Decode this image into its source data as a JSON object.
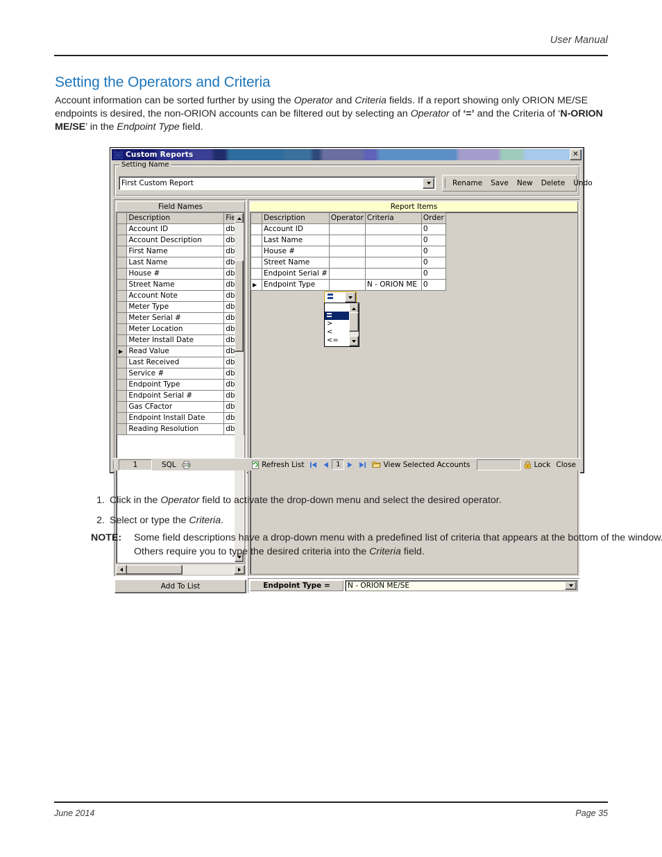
{
  "page": {
    "header_right": "User Manual",
    "footer_left": "June 2014",
    "footer_right": "Page 35",
    "section_title": "Setting the Operators and Criteria",
    "intro_parts": {
      "p1": "Account information can be sorted further by using the ",
      "i1": "Operator",
      "p2": " and ",
      "i2": "Criteria",
      "p3": " fields. If a report showing only ORION ME/SE endpoints is desired, the non-ORION accounts can be filtered out by selecting an ",
      "i3": "Operator",
      "p4": " of ",
      "b1": "‘=’",
      "p5": " and the Criteria of ‘",
      "b2": "N-ORION ME/SE",
      "p6": "’ in the ",
      "i4": "Endpoint Type",
      "p7": " field."
    },
    "steps": [
      {
        "num": "1.",
        "pre": "Click in the ",
        "em": "Operator",
        "post": " field to activate the drop-down menu and select the desired operator."
      },
      {
        "num": "2.",
        "pre": "Select or type the ",
        "em": "Criteria",
        "post": "."
      }
    ],
    "note": {
      "label": "NOTE:",
      "pre": "Some field descriptions have a drop-down menu with a predefined list of criteria that appears at the bottom of the window. Others require you to type the desired criteria into the ",
      "em": "Criteria",
      "post": " field."
    }
  },
  "dialog": {
    "title": "Custom Reports",
    "close_label": "✕",
    "group_label": "Setting Name",
    "setting_value": "First Custom Report",
    "command_buttons": [
      "Rename",
      "Save",
      "New",
      "Delete",
      "Undo"
    ],
    "field_names": {
      "panel_title": "Field Names",
      "columns": [
        "Description",
        "Fielc"
      ],
      "selected_row_index": 11,
      "rows": [
        {
          "description": "Account ID",
          "field": "dbf_"
        },
        {
          "description": "Account Description",
          "field": "dbf_"
        },
        {
          "description": "First Name",
          "field": "dbf_"
        },
        {
          "description": "Last Name",
          "field": "dbf_"
        },
        {
          "description": "House #",
          "field": "dbf_"
        },
        {
          "description": "Street Name",
          "field": "dbf_"
        },
        {
          "description": "Account Note",
          "field": "dbf_"
        },
        {
          "description": "Meter Type",
          "field": "dbf_"
        },
        {
          "description": "Meter Serial #",
          "field": "dbf_"
        },
        {
          "description": "Meter Location",
          "field": "dbf_"
        },
        {
          "description": "Meter Install Date",
          "field": "dbf_"
        },
        {
          "description": "Read Value",
          "field": "dbf_"
        },
        {
          "description": "Last Received",
          "field": "dbf_"
        },
        {
          "description": "Service #",
          "field": "dbf_"
        },
        {
          "description": "Endpoint Type",
          "field": "dbf_"
        },
        {
          "description": "Endpoint Serial #",
          "field": "dbf_"
        },
        {
          "description": "Gas CFactor",
          "field": "dbf_"
        },
        {
          "description": "Endpoint Install Date",
          "field": "dbf_"
        },
        {
          "description": "Reading Resolution",
          "field": "dbf_"
        }
      ],
      "add_button": "Add To List"
    },
    "report_items": {
      "panel_title": "Report Items",
      "columns": [
        "Description",
        "Operator",
        "Criteria",
        "Order"
      ],
      "selected_row_index": 5,
      "rows": [
        {
          "description": "Account ID",
          "operator": "",
          "criteria": "",
          "order": "0"
        },
        {
          "description": "Last Name",
          "operator": "",
          "criteria": "",
          "order": "0"
        },
        {
          "description": "House #",
          "operator": "",
          "criteria": "",
          "order": "0"
        },
        {
          "description": "Street Name",
          "operator": "",
          "criteria": "",
          "order": "0"
        },
        {
          "description": "Endpoint Serial #",
          "operator": "",
          "criteria": "",
          "order": "0"
        },
        {
          "description": "Endpoint Type",
          "operator": "=",
          "criteria": "N - ORION ME",
          "order": "0"
        }
      ]
    },
    "operator_dropdown": {
      "selected": "=",
      "options": [
        "",
        "=",
        ">",
        "<",
        "<="
      ],
      "selected_index": 1
    },
    "criteria_bar": {
      "label": "Endpoint Type  =",
      "value": "N - ORION ME/SE"
    },
    "status_bar": {
      "record_count": "1",
      "sql_label": "SQL",
      "print_icon": "printer-icon",
      "refresh_label": "Refresh List",
      "nav_first": "first-record-icon",
      "nav_prev": "previous-record-icon",
      "page_number": "1",
      "nav_next": "next-record-icon",
      "nav_last": "last-record-icon",
      "view_label": "View Selected Accounts",
      "lock_label": "Lock",
      "close_label": "Close"
    }
  },
  "colors": {
    "heading_blue": "#1d76bb",
    "dialog_face": "#d4d0c8",
    "report_items_header": "#ffffcc",
    "criteria_field": "#fffff0",
    "selection_blue": "#0a246a",
    "nav_arrow_blue": "#3b6fd4"
  }
}
